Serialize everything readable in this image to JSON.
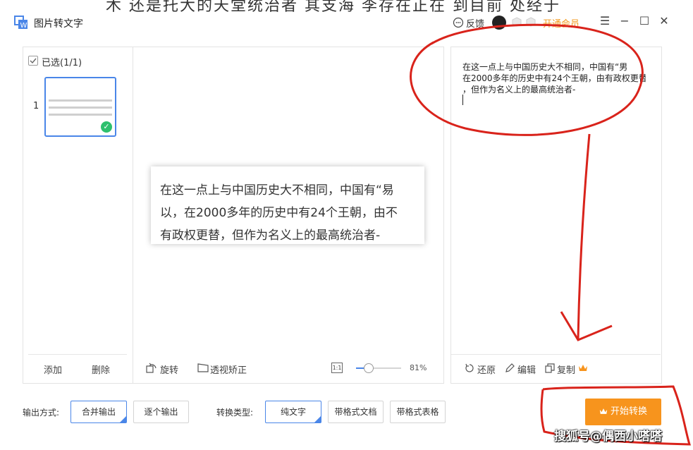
{
  "background_text": "木   还是托大的天堂统治者   其支海   李存在正在   到目前   处经于",
  "app": {
    "title": "图片转文字"
  },
  "header": {
    "feedback_label": "反馈",
    "vip_label": "开通会员"
  },
  "left_panel": {
    "selected_label": "已选(1/1)",
    "page_number": "1",
    "add_label": "添加",
    "delete_label": "删除"
  },
  "preview": {
    "lines": [
      "在这一点上与中国历史大不相同，中国有“易",
      "以，在2000多年的历史中有24个王朝，由不",
      "有政权更替，但作为名义上的最高统治者-"
    ],
    "rotate_label": "旋转",
    "perspective_label": "透视矫正",
    "fit_icon_text": "1:1",
    "zoom_percent": "81%",
    "zoom_level": 0.27
  },
  "result": {
    "lines": [
      "在这一点上与中国历史大不相同，中国有“男",
      "在2000多年的历史中有24个王朝，由有政权更替",
      "，但作为名义上的最高统治者-"
    ],
    "restore_label": "还原",
    "edit_label": "编辑",
    "copy_label": "复制"
  },
  "bottom": {
    "output_mode_label": "输出方式:",
    "merge_output": "合并输出",
    "each_output": "逐个输出",
    "convert_type_label": "转换类型:",
    "plain_text": "纯文字",
    "formatted_doc": "带格式文档",
    "formatted_table": "带格式表格",
    "start_label": "开始转换"
  },
  "watermark": "搜狐号@偶西小嗒嗒",
  "colors": {
    "accent": "#4a86e8",
    "orange": "#f7941d",
    "annotation_red": "#d9231b",
    "success": "#2ec06e"
  }
}
